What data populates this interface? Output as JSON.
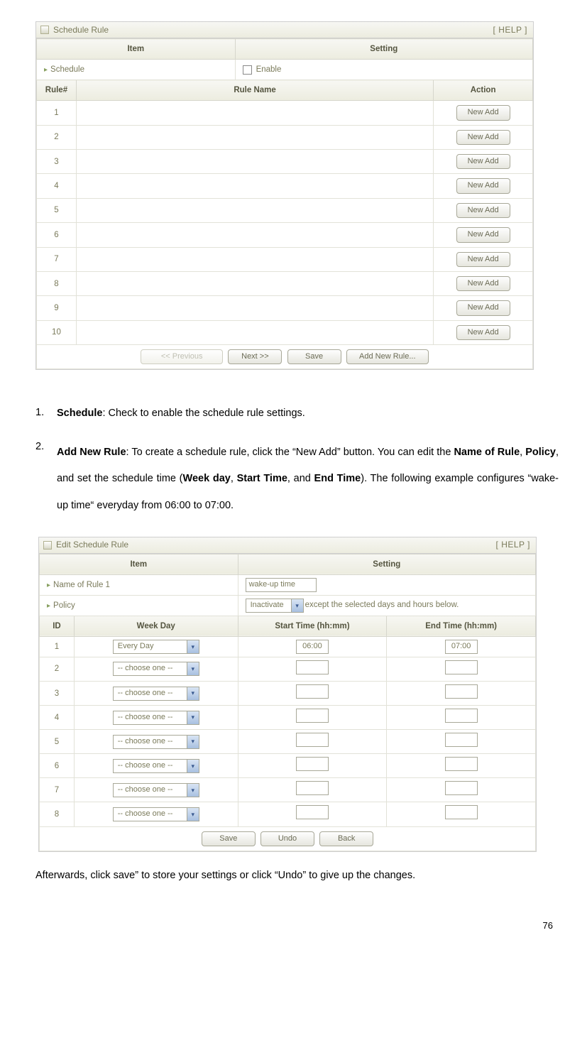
{
  "panel1": {
    "title": "Schedule Rule",
    "help": "[ HELP ]",
    "headers": {
      "item": "Item",
      "setting": "Setting",
      "rule": "Rule#",
      "rulename": "Rule Name",
      "action": "Action"
    },
    "row_schedule": "Schedule",
    "row_enable": "Enable",
    "rules": [
      "1",
      "2",
      "3",
      "4",
      "5",
      "6",
      "7",
      "8",
      "9",
      "10"
    ],
    "new_add": "New Add",
    "footer": {
      "prev": "<< Previous",
      "next": "Next >>",
      "save": "Save",
      "add": "Add New Rule..."
    }
  },
  "instructions": {
    "i1_num": "1.",
    "i1_b": "Schedule",
    "i1_rest": ": Check to enable the schedule rule settings.",
    "i2_num": "2.",
    "i2_b1": "Add New Rule",
    "i2_t1": ": To create a schedule rule, click the “New Add” button. You can edit the ",
    "i2_b2": "Name of Rule",
    "i2_t2": ", ",
    "i2_b3": "Policy",
    "i2_t3": ", and set the schedule time (",
    "i2_b4": "Week day",
    "i2_t4": ", ",
    "i2_b5": "Start Time",
    "i2_t5": ", and ",
    "i2_b6": "End Time",
    "i2_t6": "). The following example configures “wake-up time“ everyday from 06:00 to 07:00."
  },
  "panel2": {
    "title": "Edit Schedule Rule",
    "help": "[ HELP ]",
    "headers": {
      "item": "Item",
      "setting": "Setting",
      "id": "ID",
      "week": "Week Day",
      "start": "Start Time (hh:mm)",
      "end": "End Time (hh:mm)"
    },
    "name_label": "Name of Rule 1",
    "name_value": "wake-up time",
    "policy_label": "Policy",
    "policy_value": "Inactivate",
    "policy_suffix": "except the selected days and hours below.",
    "choose": "-- choose one --",
    "rows": [
      {
        "id": "1",
        "day": "Every Day",
        "start": "06:00",
        "end": "07:00"
      },
      {
        "id": "2",
        "day": "-- choose one --",
        "start": "",
        "end": ""
      },
      {
        "id": "3",
        "day": "-- choose one --",
        "start": "",
        "end": ""
      },
      {
        "id": "4",
        "day": "-- choose one --",
        "start": "",
        "end": ""
      },
      {
        "id": "5",
        "day": "-- choose one --",
        "start": "",
        "end": ""
      },
      {
        "id": "6",
        "day": "-- choose one --",
        "start": "",
        "end": ""
      },
      {
        "id": "7",
        "day": "-- choose one --",
        "start": "",
        "end": ""
      },
      {
        "id": "8",
        "day": "-- choose one --",
        "start": "",
        "end": ""
      }
    ],
    "footer": {
      "save": "Save",
      "undo": "Undo",
      "back": "Back"
    }
  },
  "after": "Afterwards, click save” to store your settings or click “Undo” to give up the changes.",
  "page": "76"
}
